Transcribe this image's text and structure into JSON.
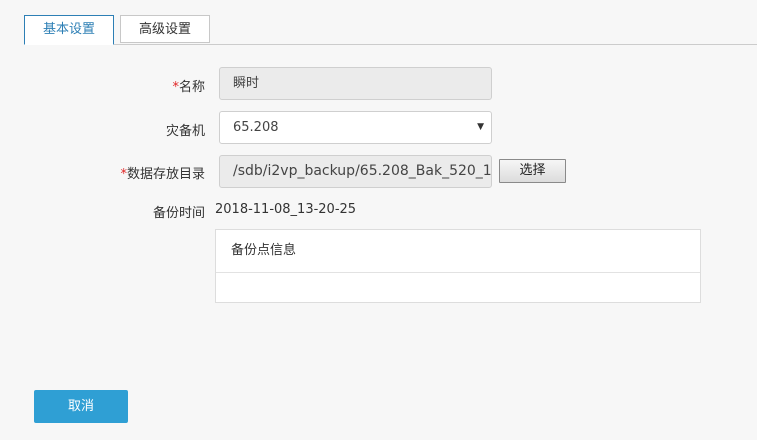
{
  "tabs": [
    {
      "label": "基本设置",
      "active": true
    },
    {
      "label": "高级设置",
      "active": false
    }
  ],
  "form": {
    "required_mark": "*",
    "name_label": "名称",
    "name_value": "瞬时",
    "dr_label": "灾备机",
    "dr_selected": "65.208",
    "dir_label": "数据存放目录",
    "dir_value": "/sdb/i2vp_backup/65.208_Bak_520_1",
    "choose_label": "选择",
    "time_label": "备份时间",
    "time_value": "2018-11-08_13-20-25",
    "info_header": "备份点信息"
  },
  "footer": {
    "cancel_label": "取消"
  },
  "colors": {
    "accent": "#2d7fb5",
    "cancel_bg": "#2f9fd4",
    "required": "#e02424"
  },
  "icons": {
    "select_caret": "caret-down-icon"
  }
}
